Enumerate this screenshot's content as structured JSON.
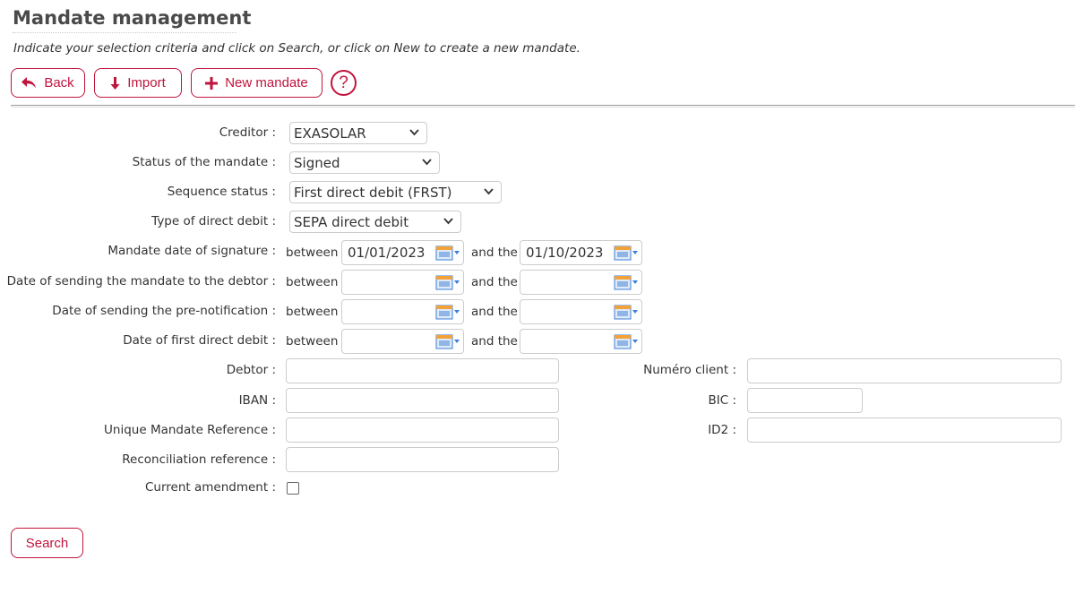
{
  "page": {
    "title": "Mandate management",
    "subtitle": "Indicate your selection criteria and click on Search, or click on New to create a new mandate."
  },
  "toolbar": {
    "back_label": "Back",
    "import_label": "Import",
    "new_label": "New mandate",
    "help_label": "?"
  },
  "form": {
    "creditor": {
      "label": "Creditor :",
      "value": "EXASOLAR"
    },
    "status": {
      "label": "Status of the mandate :",
      "value": "Signed"
    },
    "sequence": {
      "label": "Sequence status :",
      "value": "First direct debit (FRST)"
    },
    "type": {
      "label": "Type of direct debit :",
      "value": "SEPA direct debit"
    },
    "between_label": "between",
    "and_the_label": "and the",
    "signature_date": {
      "label": "Mandate date of signature :",
      "from": "01/01/2023",
      "to": "01/10/2023"
    },
    "sending_date": {
      "label": "Date of sending the mandate to the debtor :",
      "from": "",
      "to": ""
    },
    "prenotification_date": {
      "label": "Date of sending the pre-notification :",
      "from": "",
      "to": ""
    },
    "first_debit_date": {
      "label": "Date of first direct debit :",
      "from": "",
      "to": ""
    },
    "debtor": {
      "label": "Debtor :",
      "value": ""
    },
    "iban": {
      "label": "IBAN :",
      "value": ""
    },
    "umr": {
      "label": "Unique Mandate Reference :",
      "value": ""
    },
    "reconciliation": {
      "label": "Reconciliation reference :",
      "value": ""
    },
    "current_amendment": {
      "label": "Current amendment :",
      "checked": false
    },
    "client_number": {
      "label": "Numéro client :",
      "value": ""
    },
    "bic": {
      "label": "BIC :",
      "value": ""
    },
    "id2": {
      "label": "ID2 :",
      "value": ""
    }
  },
  "actions": {
    "search_label": "Search"
  },
  "colors": {
    "accent": "#c0143c",
    "calendar_blue": "#3b7fd9",
    "calendar_orange": "#f2a23a"
  }
}
